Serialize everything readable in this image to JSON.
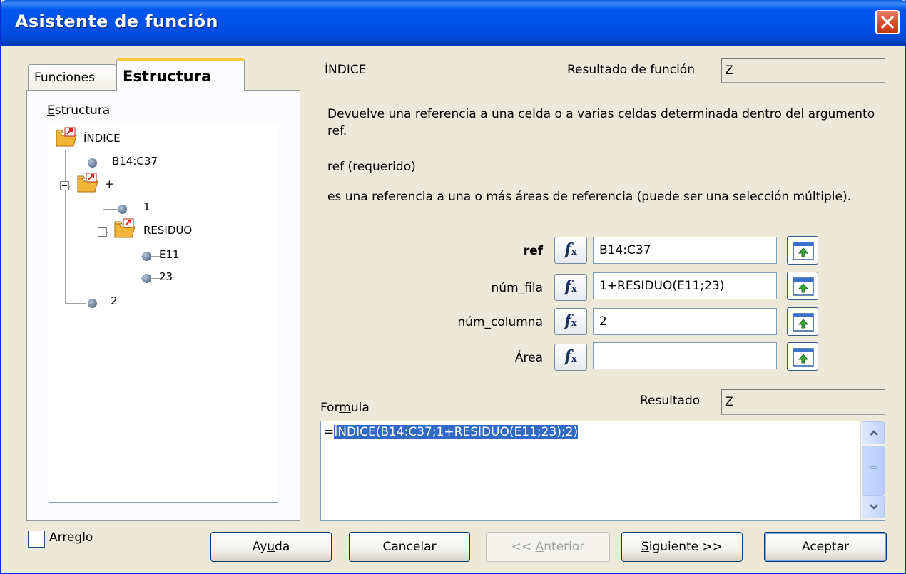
{
  "window": {
    "title": "Asistente de función",
    "title_bar_color": "#0055e5",
    "close_icon": "close-icon"
  },
  "tabs": {
    "inactive": "Funciones",
    "active": "Estructura"
  },
  "structure": {
    "label_first": "E",
    "label_rest": "structura",
    "nodes": [
      {
        "text": "ÍNDICE",
        "type": "folder"
      },
      {
        "text": "B14:C37",
        "type": "leaf"
      },
      {
        "text": "+",
        "type": "folder"
      },
      {
        "text": "1",
        "type": "leaf"
      },
      {
        "text": "RESIDUO",
        "type": "folder"
      },
      {
        "text": "E11",
        "type": "leaf"
      },
      {
        "text": "23",
        "type": "leaf"
      },
      {
        "text": "2",
        "type": "leaf"
      }
    ]
  },
  "function": {
    "name": "ÍNDICE",
    "result_label": "Resultado de función",
    "result_value": "Z",
    "description": "Devuelve una referencia a una celda o a varias celdas determinada dentro del argumento ref.",
    "arg_title": "ref (requerido)",
    "arg_description": "es una referencia a una o más áreas de referencia (puede ser una selección múltiple)."
  },
  "arguments": [
    {
      "label": "ref",
      "value": "B14:C37",
      "bold": true
    },
    {
      "label": "núm_fila",
      "value": "1+RESIDUO(E11;23)",
      "bold": false
    },
    {
      "label": "núm_columna",
      "value": "2",
      "bold": false
    },
    {
      "label": "Área",
      "value": "",
      "bold": false
    }
  ],
  "fx_label": "f",
  "fx_sub": "x",
  "formula": {
    "label_pre": "For",
    "label_u": "m",
    "label_post": "ula",
    "result_label": "Resultado",
    "result_value": "Z",
    "prefix": "=",
    "selected_text": "ÍNDICE(B14:C37;1+RESIDUO(E11;23);2)",
    "selection_color": "#316ac5"
  },
  "bottom": {
    "checkbox_pre": "Arre",
    "checkbox_u": "g",
    "checkbox_post": "lo",
    "checkbox_checked": false,
    "help_pre": "Ay",
    "help_u": "u",
    "help_post": "da",
    "cancel": "Cancelar",
    "prev_pre": "<< ",
    "prev_u": "A",
    "prev_post": "nterior",
    "next_u": "S",
    "next_post": "iguiente >>",
    "ok": "Aceptar"
  }
}
